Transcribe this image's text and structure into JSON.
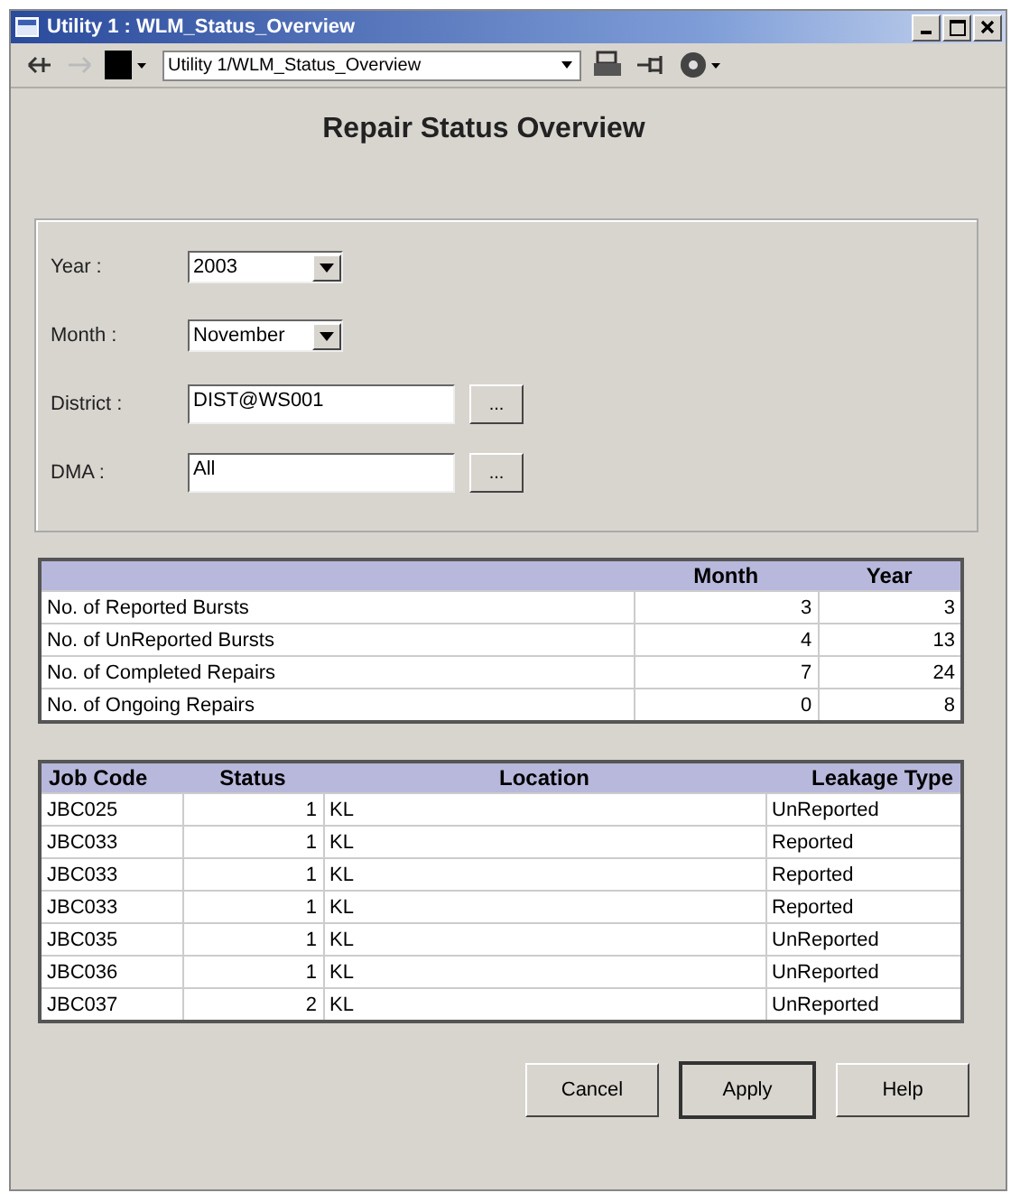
{
  "window": {
    "title": "Utility 1 : WLM_Status_Overview"
  },
  "toolbar": {
    "address": "Utility 1/WLM_Status_Overview"
  },
  "heading": "Repair Status Overview",
  "filters": [
    {
      "label": "Year :",
      "kind": "dropdown",
      "value": "2003"
    },
    {
      "label": "Month :",
      "kind": "dropdown",
      "value": "November"
    },
    {
      "label": "District :",
      "kind": "lookup",
      "value": "DIST@WS001",
      "button": "..."
    },
    {
      "label": "DMA :",
      "kind": "lookup",
      "value": "All",
      "button": "..."
    }
  ],
  "summary": {
    "columns": [
      "Month",
      "Year"
    ],
    "rows": [
      {
        "label": "No. of Reported Bursts",
        "cells": [
          "3",
          "3"
        ]
      },
      {
        "label": "No. of UnReported Bursts",
        "cells": [
          "4",
          "13"
        ]
      },
      {
        "label": "No. of Completed Repairs",
        "cells": [
          "7",
          "24"
        ]
      },
      {
        "label": "No. of Ongoing Repairs",
        "cells": [
          "0",
          "8"
        ]
      }
    ]
  },
  "jobs": {
    "columns": [
      "Job Code",
      "Status",
      "Location",
      "Leakage Type"
    ],
    "rows": [
      [
        "JBC025",
        "1",
        "KL",
        "UnReported"
      ],
      [
        "JBC033",
        "1",
        "KL",
        "Reported"
      ],
      [
        "JBC033",
        "1",
        "KL",
        "Reported"
      ],
      [
        "JBC033",
        "1",
        "KL",
        "Reported"
      ],
      [
        "JBC035",
        "1",
        "KL",
        "UnReported"
      ],
      [
        "JBC036",
        "1",
        "KL",
        "UnReported"
      ],
      [
        "JBC037",
        "2",
        "KL",
        "UnReported"
      ]
    ]
  },
  "buttons": [
    {
      "label": "Cancel",
      "default": false
    },
    {
      "label": "Apply",
      "default": true
    },
    {
      "label": "Help",
      "default": false
    }
  ]
}
